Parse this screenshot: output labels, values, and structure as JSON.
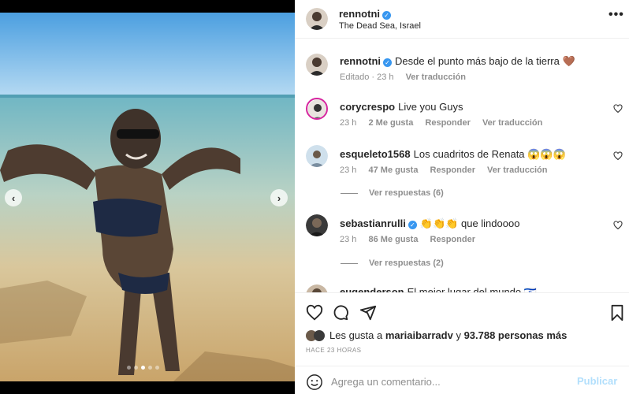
{
  "post": {
    "username": "rennotni",
    "location": "The Dead Sea, Israel",
    "more_icon": "more-horizontal-icon",
    "more_label": "•••"
  },
  "caption": {
    "username": "rennotni",
    "text": "Desde el punto más bajo de la tierra 🤎",
    "edited": "Editado · 23 h",
    "translate": "Ver traducción"
  },
  "comments": [
    {
      "username": "corycrespo",
      "text": "Live you Guys",
      "time": "23 h",
      "likes": "2 Me gusta",
      "reply": "Responder",
      "translate": "Ver traducción",
      "replies": ""
    },
    {
      "username": "esqueleto1568",
      "text": "Los cuadritos de Renata 😱😱😱",
      "time": "23 h",
      "likes": "47 Me gusta",
      "reply": "Responder",
      "translate": "Ver traducción",
      "replies": "Ver respuestas (6)"
    },
    {
      "username": "sebastianrulli",
      "text": "👏👏👏 que lindoooo",
      "time": "23 h",
      "likes": "86 Me gusta",
      "reply": "Responder",
      "translate": "",
      "replies": "Ver respuestas (2)"
    },
    {
      "username": "eugenderson",
      "text": "El mejor lugar del mundo 🇮🇱"
    }
  ],
  "likes_line": {
    "prefix": "Les gusta a ",
    "user": "mariaibarradv",
    "middle": " y ",
    "count": "93.788 personas más"
  },
  "time_ago": "HACE 23 HORAS",
  "composer": {
    "placeholder": "Agrega un comentario...",
    "publish": "Publicar"
  },
  "media": {
    "prev": "‹",
    "next": "›",
    "slide_count": 5,
    "active_slide": 2
  },
  "colors": {
    "verified": "#3897f0",
    "publish_disabled": "#b2dffc",
    "muted": "#8e8e8e"
  }
}
